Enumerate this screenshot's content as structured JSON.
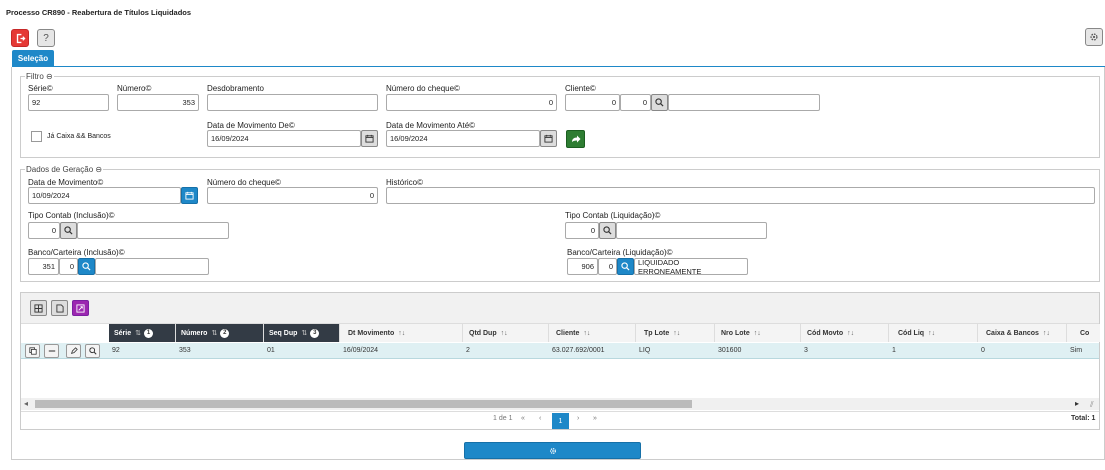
{
  "window": {
    "title": "Processo CR890 - Reabertura de Títulos Liquidados"
  },
  "toolbar": {
    "help_label": "?"
  },
  "tabs": [
    {
      "label": "Seleção"
    }
  ],
  "filtro": {
    "legend": "Filtro",
    "serie": {
      "label": "Série",
      "value": "92"
    },
    "numero": {
      "label": "Número",
      "value": "353"
    },
    "desdobramento": {
      "label": "Desdobramento",
      "value": ""
    },
    "numero_cheque": {
      "label": "Número do cheque",
      "value": "0"
    },
    "cliente": {
      "label": "Cliente",
      "value1": "0",
      "value2": "0",
      "name": ""
    },
    "ja_caixa": {
      "label": "Já Caixa && Bancos",
      "checked": false
    },
    "data_de": {
      "label": "Data de Movimento De",
      "value": "16/09/2024"
    },
    "data_ate": {
      "label": "Data de Movimento Até",
      "value": "16/09/2024"
    }
  },
  "geracao": {
    "legend": "Dados de Geração",
    "data_mov": {
      "label": "Data de Movimento",
      "value": "10/09/2024"
    },
    "numero_cheque": {
      "label": "Número do cheque",
      "value": "0"
    },
    "historico": {
      "label": "Histórico",
      "value": ""
    },
    "tipo_inclusao": {
      "label": "Tipo Contab (Inclusão)",
      "value": "0",
      "name": ""
    },
    "tipo_liquidacao": {
      "label": "Tipo Contab (Liquidação)",
      "value": "0",
      "name": ""
    },
    "banco_inclusao": {
      "label": "Banco/Carteira (Inclusão)",
      "value1": "351",
      "value2": "0",
      "name": ""
    },
    "banco_liquidacao": {
      "label": "Banco/Carteira (Liquidação)",
      "value1": "906",
      "value2": "0",
      "name": "LIQUIDADO ERRONEAMENTE"
    }
  },
  "grid": {
    "columns": [
      {
        "label": "Série",
        "sort_order": "1"
      },
      {
        "label": "Número",
        "sort_order": "2"
      },
      {
        "label": "Seq Dup",
        "sort_order": "3"
      },
      {
        "label": "Dt Movimento"
      },
      {
        "label": "Qtd Dup"
      },
      {
        "label": "Cliente"
      },
      {
        "label": "Tp Lote"
      },
      {
        "label": "Nro Lote"
      },
      {
        "label": "Cód Movto"
      },
      {
        "label": "Cód Liq"
      },
      {
        "label": "Caixa & Bancos"
      },
      {
        "label": "Co"
      }
    ],
    "rows": [
      [
        "92",
        "353",
        "01",
        "16/09/2024",
        "2",
        "63.027.692/0001",
        "LIQ",
        "301600",
        "3",
        "1",
        "0",
        "Sim"
      ]
    ],
    "pager": {
      "range": "1 de 1",
      "first": "«",
      "prev": "‹",
      "page": "1",
      "next": "›",
      "last": "»",
      "total": "Total: 1"
    }
  },
  "colors": {
    "accent": "#1e88c8",
    "exit": "#e53935",
    "confirm": "#2e7d32",
    "export": "#9c27b0"
  }
}
